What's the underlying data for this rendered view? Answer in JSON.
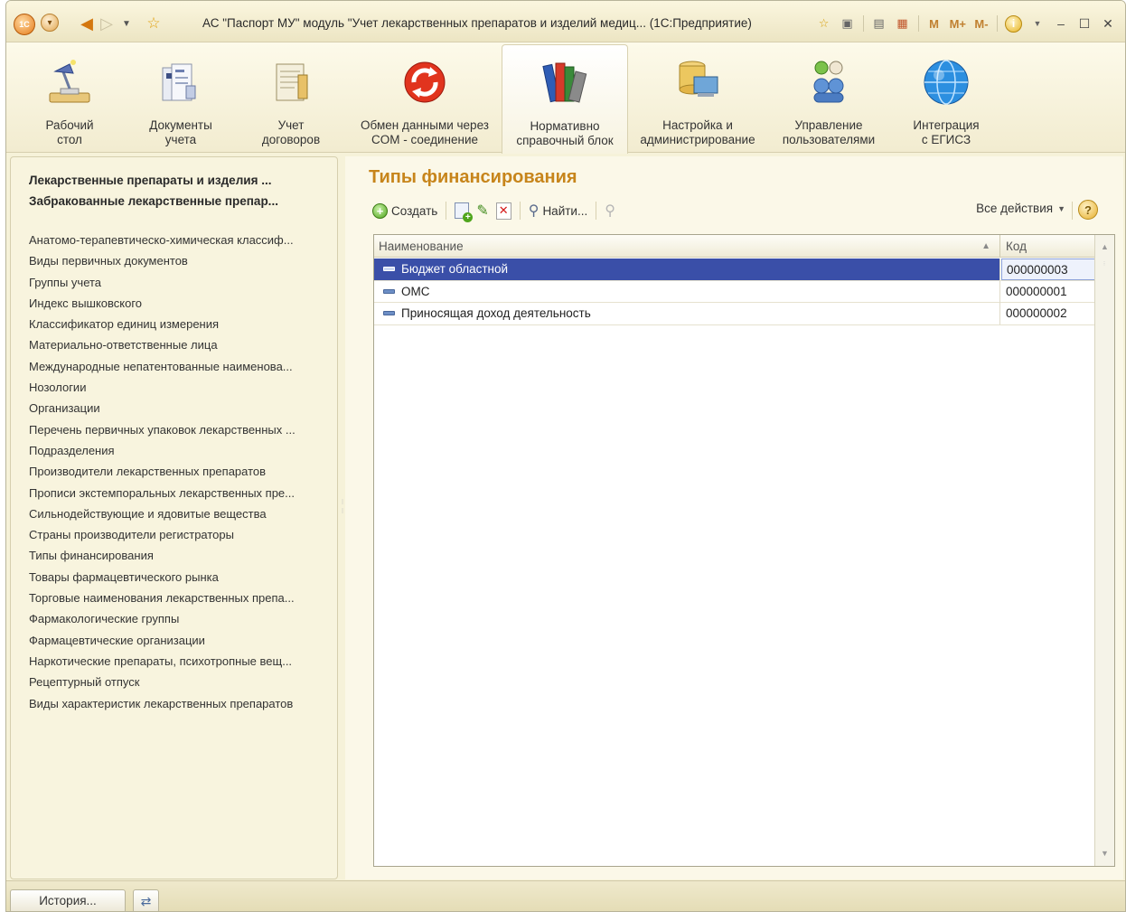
{
  "window": {
    "title": "АС \"Паспорт МУ\" модуль \"Учет лекарственных препаратов и изделий медиц... (1С:Предприятие)",
    "logo_text": "1С",
    "m_labels": [
      "M",
      "M+",
      "M-"
    ]
  },
  "sections": [
    {
      "label": "Рабочий\nстол",
      "icon": "desk-lamp-icon"
    },
    {
      "label": "Документы\nучета",
      "icon": "documents-icon"
    },
    {
      "label": "Учет\nдоговоров",
      "icon": "contracts-icon"
    },
    {
      "label": "Обмен данными через\nCOM - соединение",
      "icon": "exchange-icon"
    },
    {
      "label": "Нормативно\nсправочный блок",
      "icon": "books-icon",
      "active": true
    },
    {
      "label": "Настройка и\nадминистрирование",
      "icon": "admin-icon"
    },
    {
      "label": "Управление\nпользователями",
      "icon": "users-icon"
    },
    {
      "label": "Интеграция\nс ЕГИСЗ",
      "icon": "globe-icon"
    }
  ],
  "nav": {
    "bold_links": [
      "Лекарственные препараты и изделия ...",
      "Забракованные лекарственные препар..."
    ],
    "links": [
      "Анатомо-терапевтическо-химическая классиф...",
      "Виды первичных документов",
      "Группы учета",
      "Индекс вышковского",
      "Классификатор единиц измерения",
      "Материально-ответственные лица",
      "Международные непатентованные наименова...",
      "Нозологии",
      "Организации",
      "Перечень первичных упаковок лекарственных ...",
      "Подразделения",
      "Производители лекарственных препаратов",
      "Прописи экстемпоральных лекарственных пре...",
      "Сильнодействующие и ядовитые вещества",
      "Страны производители регистраторы",
      "Типы финансирования",
      "Товары фармацевтического рынка",
      "Торговые наименования лекарственных препа...",
      "Фармакологические группы",
      "Фармацевтические организации",
      "Наркотические препараты, психотропные вещ...",
      "Рецептурный отпуск",
      "Виды характеристик лекарственных препаратов"
    ]
  },
  "form": {
    "title": "Типы финансирования",
    "toolbar": {
      "create_label": "Создать",
      "find_label": "Найти...",
      "all_actions_label": "Все действия",
      "help_glyph": "?"
    },
    "columns": {
      "name": "Наименование",
      "code": "Код"
    },
    "rows": [
      {
        "name": "Бюджет областной",
        "code": "000000003",
        "selected": true
      },
      {
        "name": "ОМС",
        "code": "000000001"
      },
      {
        "name": "Приносящая доход деятельность",
        "code": "000000002"
      }
    ]
  },
  "bottom": {
    "history_label": "История..."
  },
  "colors": {
    "accent_title": "#c7851b",
    "selection": "#3a4fa8",
    "panel_bg": "#f6f2d9"
  }
}
